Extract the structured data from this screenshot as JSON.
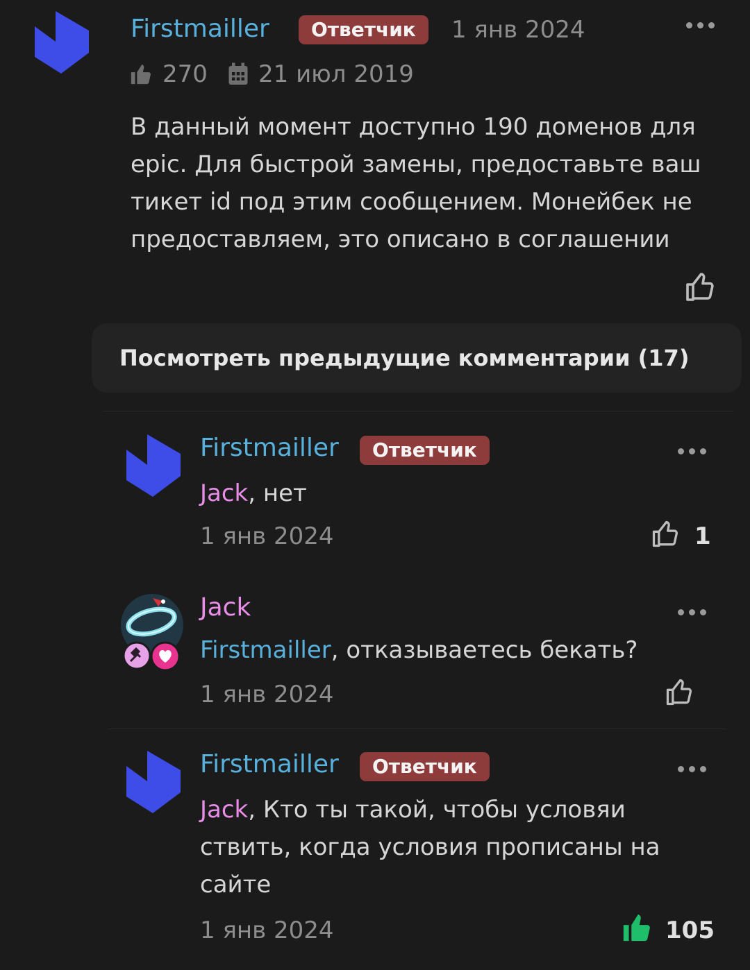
{
  "colors": {
    "background": "#1b1b1c",
    "author": "#58b1dd",
    "mention": "#e98de8",
    "badge": "#8e3b3b",
    "liked": "#1fbe6a"
  },
  "main_post": {
    "author": "Firstmailler",
    "badge": "Ответчик",
    "date": "1 янв 2024",
    "likes": "270",
    "registered": "21 июл 2019",
    "body": "В данный момент доступно 190 доменов для epic. Для быстрой замены, предоставьте ваш тикет id под этим сообщением. Монейбек не предоставляем, это описано в соглашении",
    "icons": [
      "logo-icon",
      "thumbs-up-filled-icon",
      "calendar-icon",
      "more-icon",
      "thumbs-up-outline-icon"
    ]
  },
  "load_more": {
    "label": "Посмотреть предыдущие комментарии (17)"
  },
  "comments": [
    {
      "author": "Firstmailler",
      "badge": "Ответчик",
      "mention": "Jack",
      "text": ", нет",
      "date": "1 янв 2024",
      "likes": "1",
      "liked": false
    },
    {
      "author": "Jack",
      "mention": "Firstmailler",
      "text": ", отказываетесь бекать?",
      "date": "1 янв 2024",
      "likes": "",
      "liked": false,
      "avatar_badges": [
        "hammer-icon",
        "heart-icon"
      ]
    },
    {
      "author": "Firstmailler",
      "badge": "Ответчик",
      "mention": "Jack",
      "text_lines": [
        ", Кто ты такой, чтобы условяи",
        "ствить, когда условия прописаны на",
        "сайте"
      ],
      "date": "1 янв 2024",
      "likes": "105",
      "liked": true
    }
  ]
}
